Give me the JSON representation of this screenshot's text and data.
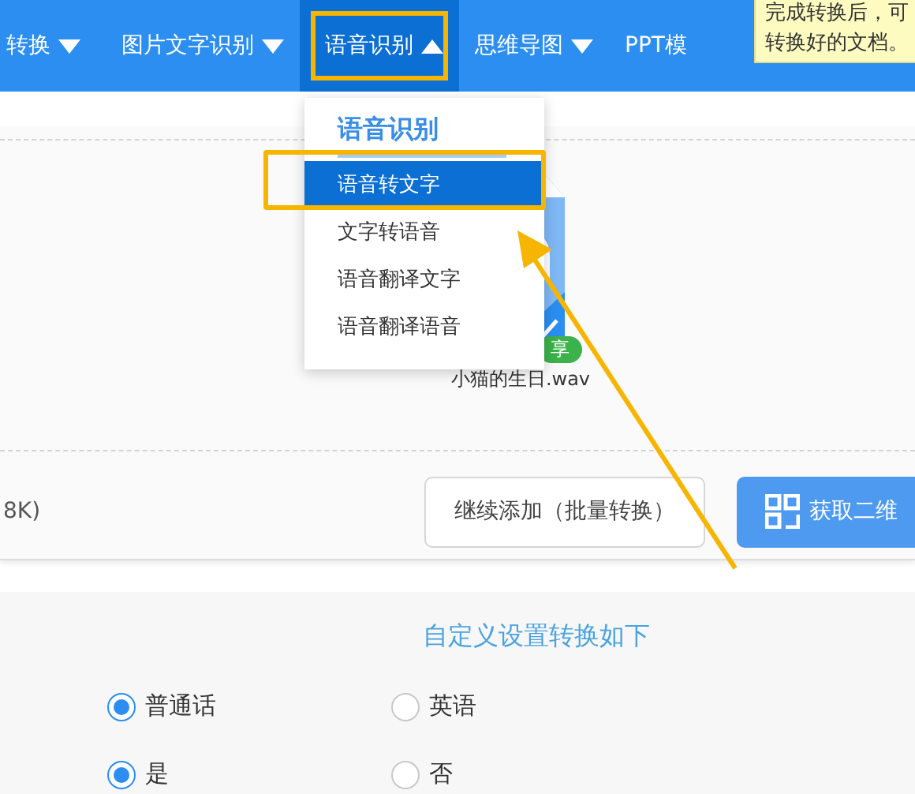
{
  "nav": {
    "items": [
      {
        "label": "转换",
        "selected": false,
        "highlighted": false
      },
      {
        "label": "图片文字识别",
        "selected": false,
        "highlighted": false
      },
      {
        "label": "语音识别",
        "selected": true,
        "highlighted": true
      },
      {
        "label": "思维导图",
        "selected": false,
        "highlighted": false
      },
      {
        "label": "PPT模",
        "selected": false,
        "highlighted": false
      }
    ]
  },
  "tooltip": {
    "lines": [
      "完成转换后，可",
      "转换好的文档。"
    ]
  },
  "dropdown": {
    "title": "语音识别",
    "items": [
      {
        "label": "语音转文字",
        "selected": true,
        "highlighted": true
      },
      {
        "label": "文字转语音",
        "selected": false,
        "highlighted": false
      },
      {
        "label": "语音翻译文字",
        "selected": false,
        "highlighted": false
      },
      {
        "label": "语音翻译语音",
        "selected": false,
        "highlighted": false
      }
    ]
  },
  "file": {
    "badge": "享",
    "name": "小猫的生日.wav",
    "checked": true
  },
  "upload_bar": {
    "size": "8K)",
    "buttons": [
      {
        "kind": "outline",
        "label": "继续添加（批量转换）"
      },
      {
        "kind": "primary",
        "label": "获取二维"
      }
    ]
  },
  "settings": {
    "title": "自定义设置转换如下",
    "groups": [
      [
        {
          "label": "普通话",
          "selected": true
        },
        {
          "label": "英语",
          "selected": false
        }
      ],
      [
        {
          "label": "是",
          "selected": true
        },
        {
          "label": "否",
          "selected": false
        }
      ]
    ]
  }
}
